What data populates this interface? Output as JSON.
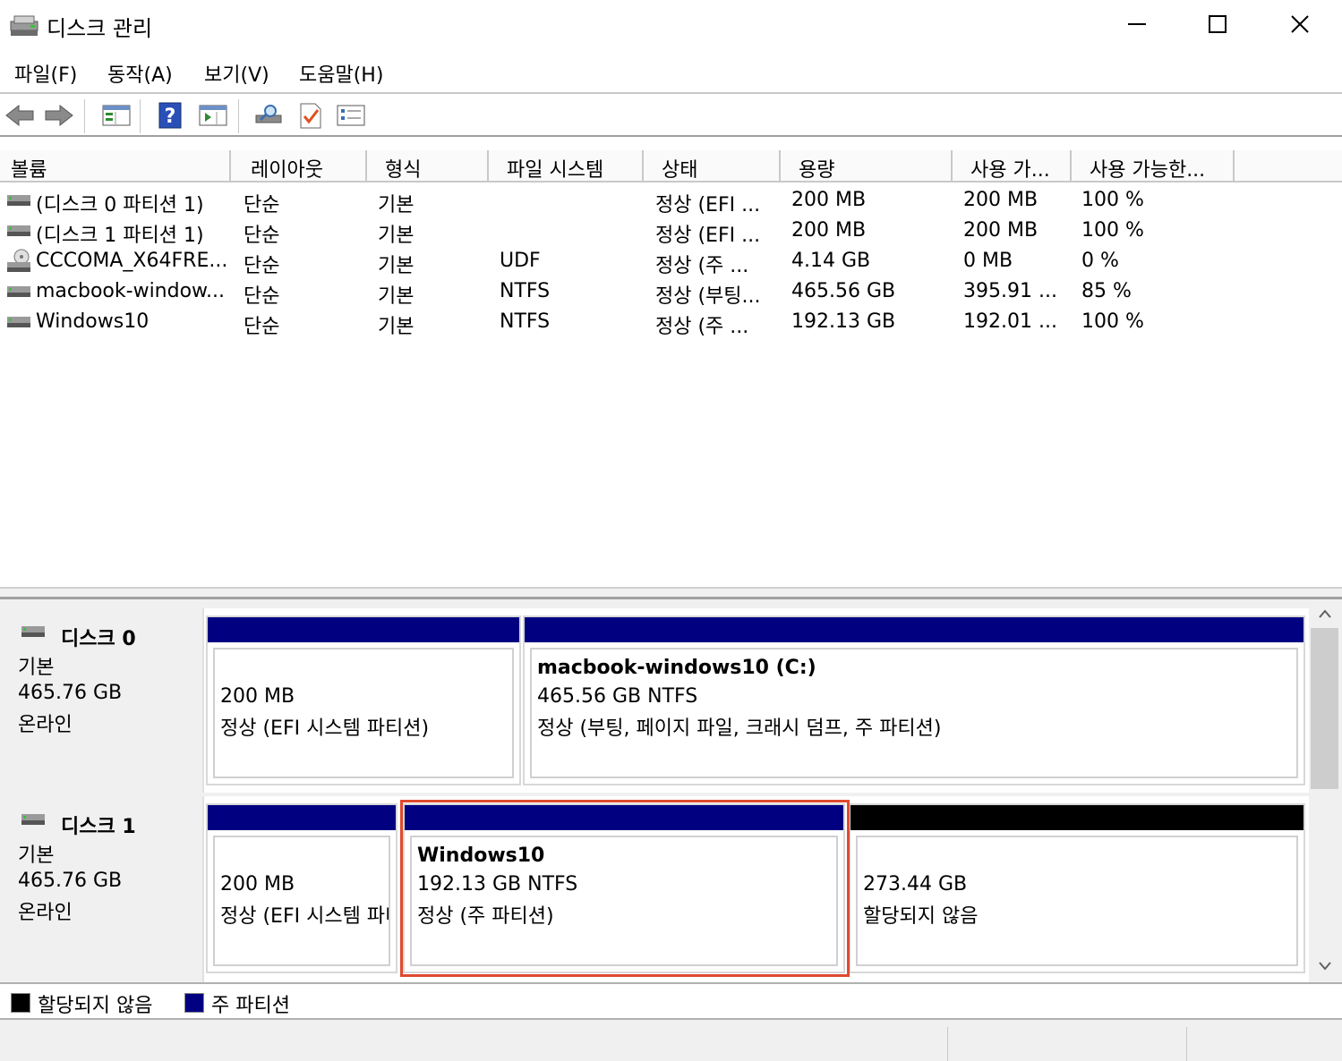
{
  "window": {
    "title": "디스크 관리",
    "controls": {
      "minimize": "minimize-icon",
      "maximize": "maximize-icon",
      "close": "close-icon"
    }
  },
  "menu": [
    "파일(F)",
    "동작(A)",
    "보기(V)",
    "도움말(H)"
  ],
  "toolbar": {
    "icons": [
      "back-icon",
      "forward-icon",
      "console-tree-icon",
      "help-icon",
      "action-pane-icon",
      "connect-icon",
      "check-icon",
      "properties-icon"
    ]
  },
  "volume_list": {
    "columns": [
      "볼륨",
      "레이아웃",
      "형식",
      "파일 시스템",
      "상태",
      "용량",
      "사용 가...",
      "사용 가능한..."
    ],
    "rows": [
      {
        "icon": "drive-icon",
        "cells": [
          "(디스크 0 파티션 1)",
          "단순",
          "기본",
          "",
          "정상 (EFI ...",
          "200 MB",
          "200 MB",
          "100 %"
        ]
      },
      {
        "icon": "drive-icon",
        "cells": [
          "(디스크 1 파티션 1)",
          "단순",
          "기본",
          "",
          "정상 (EFI ...",
          "200 MB",
          "200 MB",
          "100 %"
        ]
      },
      {
        "icon": "cd-drive-icon",
        "cells": [
          "CCCOMA_X64FRE...",
          "단순",
          "기본",
          "UDF",
          "정상 (주 ...",
          "4.14 GB",
          "0 MB",
          "0 %"
        ]
      },
      {
        "icon": "drive-icon",
        "cells": [
          "macbook-window...",
          "단순",
          "기본",
          "NTFS",
          "정상 (부팅...",
          "465.56 GB",
          "395.91 ...",
          "85 %"
        ]
      },
      {
        "icon": "drive-icon",
        "cells": [
          "Windows10",
          "단순",
          "기본",
          "NTFS",
          "정상 (주 ...",
          "192.13 GB",
          "192.01 ...",
          "100 %"
        ]
      }
    ]
  },
  "disks": [
    {
      "name": "디스크 0",
      "type": "기본",
      "size": "465.76 GB",
      "status": "온라인",
      "partitions": [
        {
          "title": "",
          "size": "200 MB",
          "status": "정상 (EFI 시스템 파티션)"
        },
        {
          "title": "macbook-windows10  (C:)",
          "size": "465.56 GB NTFS",
          "status": "정상 (부팅, 페이지 파일, 크래시 덤프, 주 파티션)"
        }
      ]
    },
    {
      "name": "디스크 1",
      "type": "기본",
      "size": "465.76 GB",
      "status": "온라인",
      "partitions": [
        {
          "title": "",
          "size": "200 MB",
          "status": "정상 (EFI 시스템 파티션)"
        },
        {
          "title": "Windows10",
          "size": "192.13 GB NTFS",
          "status": "정상 (주 파티션)"
        },
        {
          "title": "",
          "size": "273.44 GB",
          "status": "할당되지 않음"
        }
      ]
    }
  ],
  "legend": [
    {
      "label": "할당되지 않음",
      "color": "#000000"
    },
    {
      "label": "주 파티션",
      "color": "#000080"
    }
  ],
  "colors": {
    "primary_partition": "#000080",
    "unallocated": "#000000",
    "highlight": "#e04a2e"
  }
}
